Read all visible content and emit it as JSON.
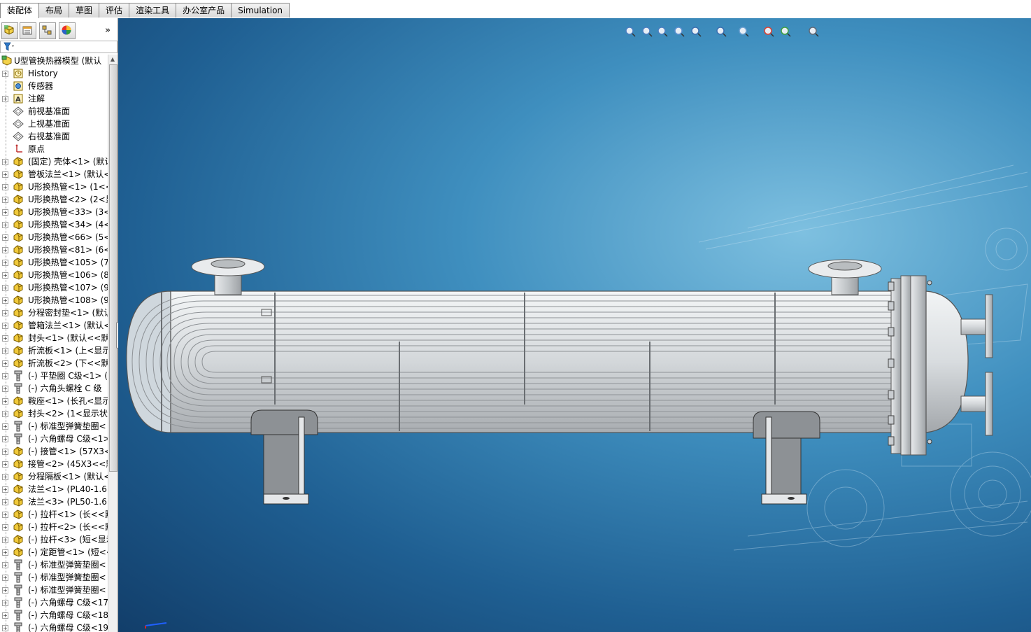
{
  "tabs": [
    {
      "label": "装配体",
      "active": true
    },
    {
      "label": "布局",
      "active": false
    },
    {
      "label": "草图",
      "active": false
    },
    {
      "label": "评估",
      "active": false
    },
    {
      "label": "渲染工具",
      "active": false
    },
    {
      "label": "办公室产品",
      "active": false
    },
    {
      "label": "Simulation",
      "active": false
    }
  ],
  "sidebar": {
    "toolbar_icons": [
      "feature-manager-icon",
      "property-manager-icon",
      "configuration-manager-icon",
      "display-manager-icon"
    ],
    "expand_glyph": "»",
    "filter_icon": "filter-icon",
    "tree": [
      {
        "label": "U型管换热器模型  (默认",
        "icon": "assembly-icon",
        "expander": false,
        "root": true
      },
      {
        "label": "History",
        "icon": "history-icon",
        "expander": true
      },
      {
        "label": "传感器",
        "icon": "sensor-icon",
        "expander": false
      },
      {
        "label": "注解",
        "icon": "annotation-icon",
        "expander": true
      },
      {
        "label": "前视基准面",
        "icon": "plane-icon",
        "expander": false
      },
      {
        "label": "上视基准面",
        "icon": "plane-icon",
        "expander": false
      },
      {
        "label": "右视基准面",
        "icon": "plane-icon",
        "expander": false
      },
      {
        "label": "原点",
        "icon": "origin-icon",
        "expander": false
      },
      {
        "label": "(固定) 壳体<1> (默认",
        "icon": "part-icon",
        "expander": true
      },
      {
        "label": "管板法兰<1> (默认<",
        "icon": "part-icon",
        "expander": true
      },
      {
        "label": "U形换热管<1> (1<<",
        "icon": "part-icon",
        "expander": true
      },
      {
        "label": "U形换热管<2> (2<显",
        "icon": "part-icon",
        "expander": true
      },
      {
        "label": "U形换热管<33> (3<",
        "icon": "part-icon",
        "expander": true
      },
      {
        "label": "U形换热管<34> (4<",
        "icon": "part-icon",
        "expander": true
      },
      {
        "label": "U形换热管<66> (5<",
        "icon": "part-icon",
        "expander": true
      },
      {
        "label": "U形换热管<81> (6<",
        "icon": "part-icon",
        "expander": true
      },
      {
        "label": "U形换热管<105> (7",
        "icon": "part-icon",
        "expander": true
      },
      {
        "label": "U形换热管<106> (8",
        "icon": "part-icon",
        "expander": true
      },
      {
        "label": "U形换热管<107> (9",
        "icon": "part-icon",
        "expander": true
      },
      {
        "label": "U形换热管<108> (9",
        "icon": "part-icon",
        "expander": true
      },
      {
        "label": "分程密封垫<1> (默认",
        "icon": "part-icon",
        "expander": true
      },
      {
        "label": "管箱法兰<1> (默认<",
        "icon": "part-icon",
        "expander": true
      },
      {
        "label": "封头<1> (默认<<默",
        "icon": "part-icon",
        "expander": true
      },
      {
        "label": "折流板<1> (上<显示",
        "icon": "part-icon",
        "expander": true
      },
      {
        "label": "折流板<2> (下<<默",
        "icon": "part-icon",
        "expander": true
      },
      {
        "label": "(-) 平垫圈 C级<1> (",
        "icon": "toolbox-part-icon",
        "expander": true
      },
      {
        "label": "(-) 六角头螺栓 C 级",
        "icon": "toolbox-part-icon",
        "expander": true
      },
      {
        "label": "鞍座<1> (长孔<显示",
        "icon": "part-icon",
        "expander": true
      },
      {
        "label": "封头<2> (1<显示状",
        "icon": "part-icon",
        "expander": true
      },
      {
        "label": "(-) 标准型弹簧垫圈<",
        "icon": "toolbox-part-icon",
        "expander": true
      },
      {
        "label": "(-) 六角螺母 C级<1>",
        "icon": "toolbox-part-icon",
        "expander": true
      },
      {
        "label": "(-) 接管<1> (57X3<",
        "icon": "part-icon",
        "expander": true
      },
      {
        "label": "接管<2> (45X3<<默",
        "icon": "part-icon",
        "expander": true
      },
      {
        "label": "分程隔板<1> (默认<",
        "icon": "part-icon",
        "expander": true
      },
      {
        "label": "法兰<1> (PL40-1.6R",
        "icon": "part-icon",
        "expander": true
      },
      {
        "label": "法兰<3> (PL50-1.6R",
        "icon": "part-icon",
        "expander": true
      },
      {
        "label": "(-) 拉杆<1> (长<<默",
        "icon": "part-icon",
        "expander": true
      },
      {
        "label": "(-) 拉杆<2> (长<<默",
        "icon": "part-icon",
        "expander": true
      },
      {
        "label": "(-) 拉杆<3> (短<显示",
        "icon": "part-icon",
        "expander": true
      },
      {
        "label": "(-) 定距管<1> (短<<",
        "icon": "part-icon",
        "expander": true
      },
      {
        "label": "(-) 标准型弹簧垫圈<",
        "icon": "toolbox-part-icon",
        "expander": true
      },
      {
        "label": "(-) 标准型弹簧垫圈<",
        "icon": "toolbox-part-icon",
        "expander": true
      },
      {
        "label": "(-) 标准型弹簧垫圈<",
        "icon": "toolbox-part-icon",
        "expander": true
      },
      {
        "label": "(-) 六角螺母 C级<17",
        "icon": "toolbox-part-icon",
        "expander": true
      },
      {
        "label": "(-) 六角螺母 C级<18",
        "icon": "toolbox-part-icon",
        "expander": true
      },
      {
        "label": "(-) 六角螺母 C级<19",
        "icon": "toolbox-part-icon",
        "expander": true
      }
    ]
  },
  "view_toolbar_icons": [
    "zoom-to-fit-icon",
    "zoom-to-area-icon",
    "previous-view-icon",
    "section-view-icon",
    "view-orientation-icon",
    "display-style-icon",
    "hide-show-items-icon",
    "edit-appearance-icon",
    "apply-scene-icon",
    "view-settings-icon"
  ],
  "model": {
    "description_icon": "u-tube-heat-exchanger-model",
    "shell_color": "#d9dde0",
    "tube_color": "#c9cdd0",
    "saddle_color": "#8d9195",
    "background_top": "#3f8fbf",
    "background_bottom": "#123e6a"
  }
}
